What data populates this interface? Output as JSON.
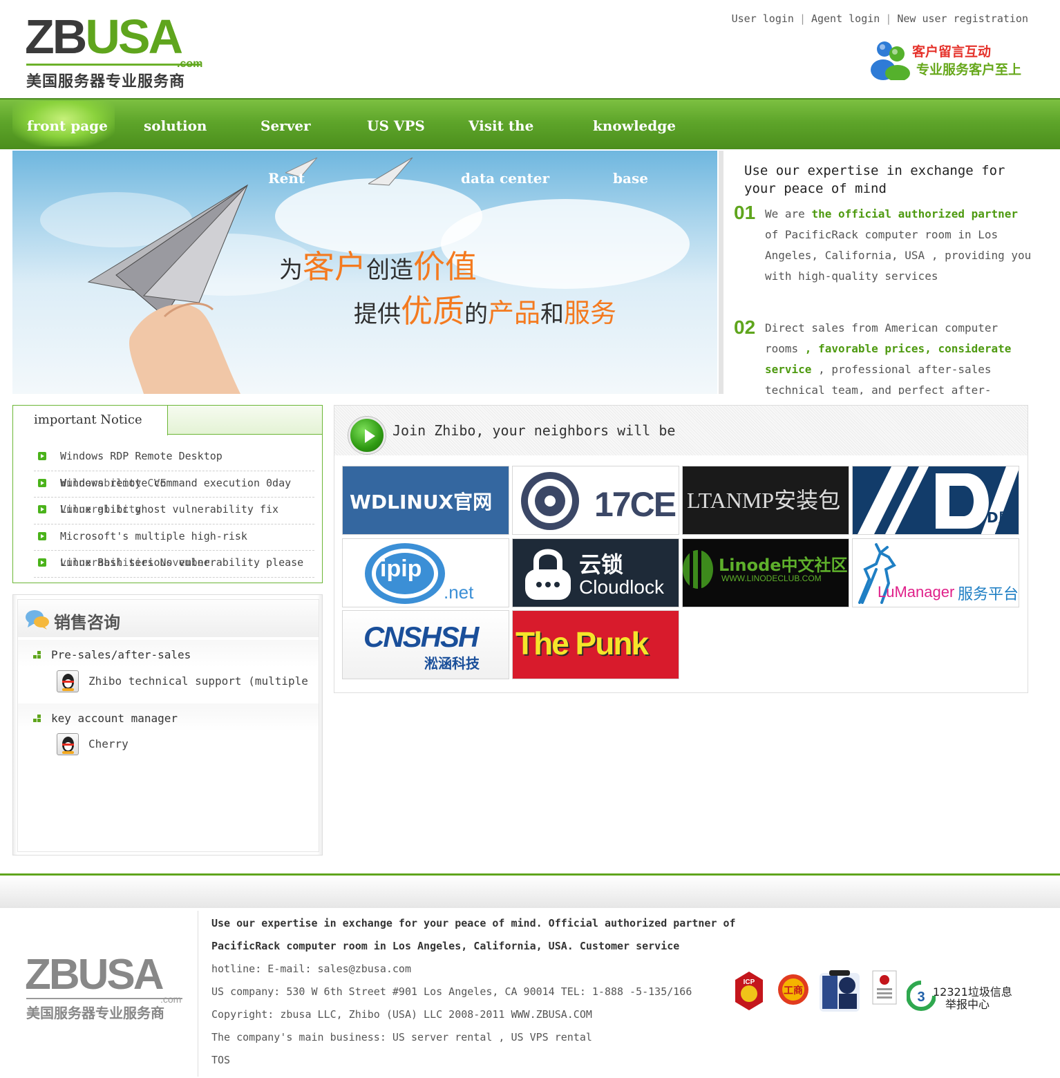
{
  "header": {
    "logo_main_1": "ZB",
    "logo_main_2": "USA",
    "logo_com": ".com",
    "logo_cn": "美国服务器专业服务商",
    "links": {
      "user_login": "User login",
      "agent_login": "Agent login",
      "register": "New user registration",
      "sep": "|"
    },
    "msg_badge": {
      "line1": "客户留言互动",
      "line2": "专业服务客户至上"
    }
  },
  "nav": {
    "items": [
      {
        "label": "front page",
        "active": true
      },
      {
        "label": "solution"
      },
      {
        "label": "Server"
      },
      {
        "label": "US VPS"
      },
      {
        "label": "Visit the"
      },
      {
        "label": "knowledge"
      }
    ],
    "overflow": {
      "server": "Rent",
      "visit": "data center",
      "knowledge": "base"
    }
  },
  "banner": {
    "line1_a": "为",
    "line1_b": "客户",
    "line1_c": "创造",
    "line1_d": "价值",
    "line2_a": "提供",
    "line2_b": "优质",
    "line2_c": "的",
    "line2_d": "产品",
    "line2_e": "和",
    "line2_f": "服务"
  },
  "intro": {
    "title": "Use our expertise in exchange for your peace of mind",
    "p1": {
      "num": "01",
      "a": "We are ",
      "b": "the official authorized partner",
      "c": " of PacificRack computer room in Los Angeles, California, USA , providing you with high-quality services"
    },
    "p2": {
      "num": "02",
      "a": "Direct sales from American computer rooms ",
      "b": ", favorable prices, considerate service",
      "c": " , professional after-sales technical team, and perfect after-"
    }
  },
  "notice": {
    "title": "important Notice",
    "items": [
      {
        "text": "Windows RDP Remote Desktop"
      },
      {
        "text": "Windows remote command execution 0day",
        "overlap": "Vulnerability CVE"
      },
      {
        "text": "Linux glibc ghost vulnerability fix",
        "overlap": "Vulnerability"
      },
      {
        "text": "Microsoft's multiple high-risk"
      },
      {
        "text": "Linux Bash serious vulnerability please",
        "overlap": "vulnerabilities November"
      }
    ]
  },
  "sales": {
    "title": "销售咨询",
    "groups": [
      {
        "title": "Pre-sales/after-sales",
        "contact": "Zhibo technical support (multiple"
      },
      {
        "title": "key account manager",
        "contact": "Cherry"
      }
    ]
  },
  "partners": {
    "title": "Join Zhibo, your neighbors will be",
    "tiles": [
      {
        "text": "WDLINUX官网"
      },
      {
        "text": "17CE"
      },
      {
        "text": "LTANMP安装包"
      },
      {
        "text": "D盾"
      },
      {
        "text": "ipip",
        "sub": ".net"
      },
      {
        "text": "云锁",
        "sub": "Cloudlock"
      },
      {
        "text": "Linode中文社区",
        "sub": "WWW.LINODECLUB.COM"
      },
      {
        "text": "LuManager",
        "sub": "服务平台"
      },
      {
        "text": "CNSHSH",
        "sub": "淞涵科技"
      },
      {
        "text": "The Punk"
      }
    ]
  },
  "footer": {
    "logo_main": "ZBUSA",
    "logo_com": ".com",
    "logo_cn": "美国服务器专业服务商",
    "line1": "Use our expertise in exchange for your peace of mind. Official authorized partner of",
    "line2": "PacificRack computer room in Los Angeles, California, USA. Customer service",
    "line3": "hotline: E-mail: sales@zbusa.com",
    "line4": "US company: 530 W 6th Street #901 Los Angeles, CA 90014 TEL: 1-888 -5-135/166",
    "line5": "Copyright: zbusa LLC, Zhibo (USA) LLC 2008-2011 WWW.ZBUSA.COM",
    "line6": "The company's main business: US server rental , US VPS rental",
    "line7": "TOS",
    "badge_12321_top": "12321垃圾信息",
    "badge_12321_bottom": "举报中心",
    "badge_icp": "ICP",
    "badge_seal": "工商"
  },
  "colors": {
    "brand_green": "#5fa51d",
    "nav_green": "#5ea52a",
    "accent_orange": "#f47a1f",
    "accent_red": "#e5322b"
  }
}
